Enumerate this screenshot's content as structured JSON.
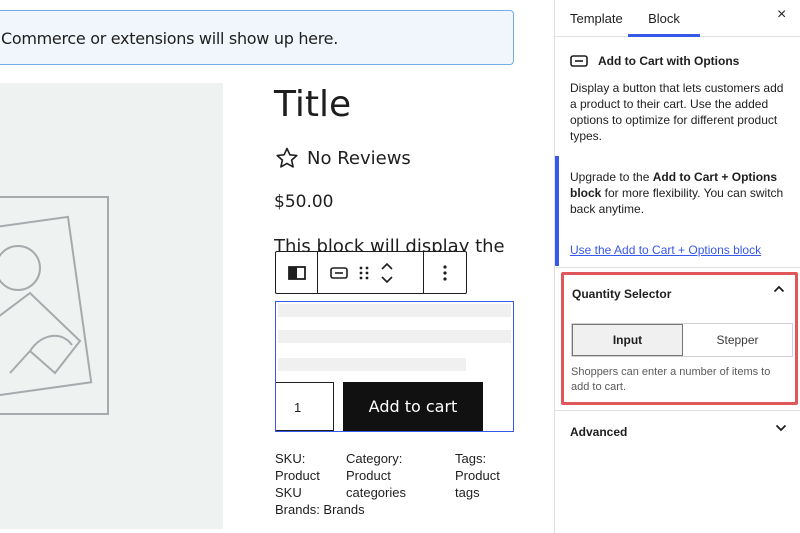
{
  "notice": {
    "text": "Commerce or extensions will show up here."
  },
  "product": {
    "title": "Title",
    "rating_text": "No Reviews",
    "price": "$50.00",
    "description": "This block will display the excerpt."
  },
  "add_to_cart": {
    "quantity": "1",
    "button_label": "Add to cart"
  },
  "meta": {
    "sku": "SKU: Product SKU",
    "category": "Category: Product categories",
    "tags": "Tags: Product tags",
    "brands": "Brands: Brands"
  },
  "sidebar": {
    "tabs": [
      {
        "label": "Template"
      },
      {
        "label": "Block"
      }
    ],
    "active_tab": "Block",
    "close_icon": "×",
    "block": {
      "name": "Add to Cart with Options",
      "description": "Display a button that lets customers add a product to their cart. Use the added options to optimize for different product types."
    },
    "upgrade": {
      "text_before": "Upgrade to the ",
      "text_bold": "Add to Cart + Options block",
      "text_after": " for more flexibility. You can switch back anytime.",
      "link": "Use the Add to Cart + Options block"
    },
    "quantity_selector": {
      "title": "Quantity Selector",
      "options": [
        "Input",
        "Stepper"
      ],
      "selected": "Input",
      "help": "Shoppers can enter a number of items to add to cart."
    },
    "advanced": {
      "title": "Advanced"
    }
  },
  "colors": {
    "accent": "#3858e9",
    "highlight_border": "#e0575b",
    "notice_bg": "#f0f6fc",
    "button_bg": "#111111"
  }
}
